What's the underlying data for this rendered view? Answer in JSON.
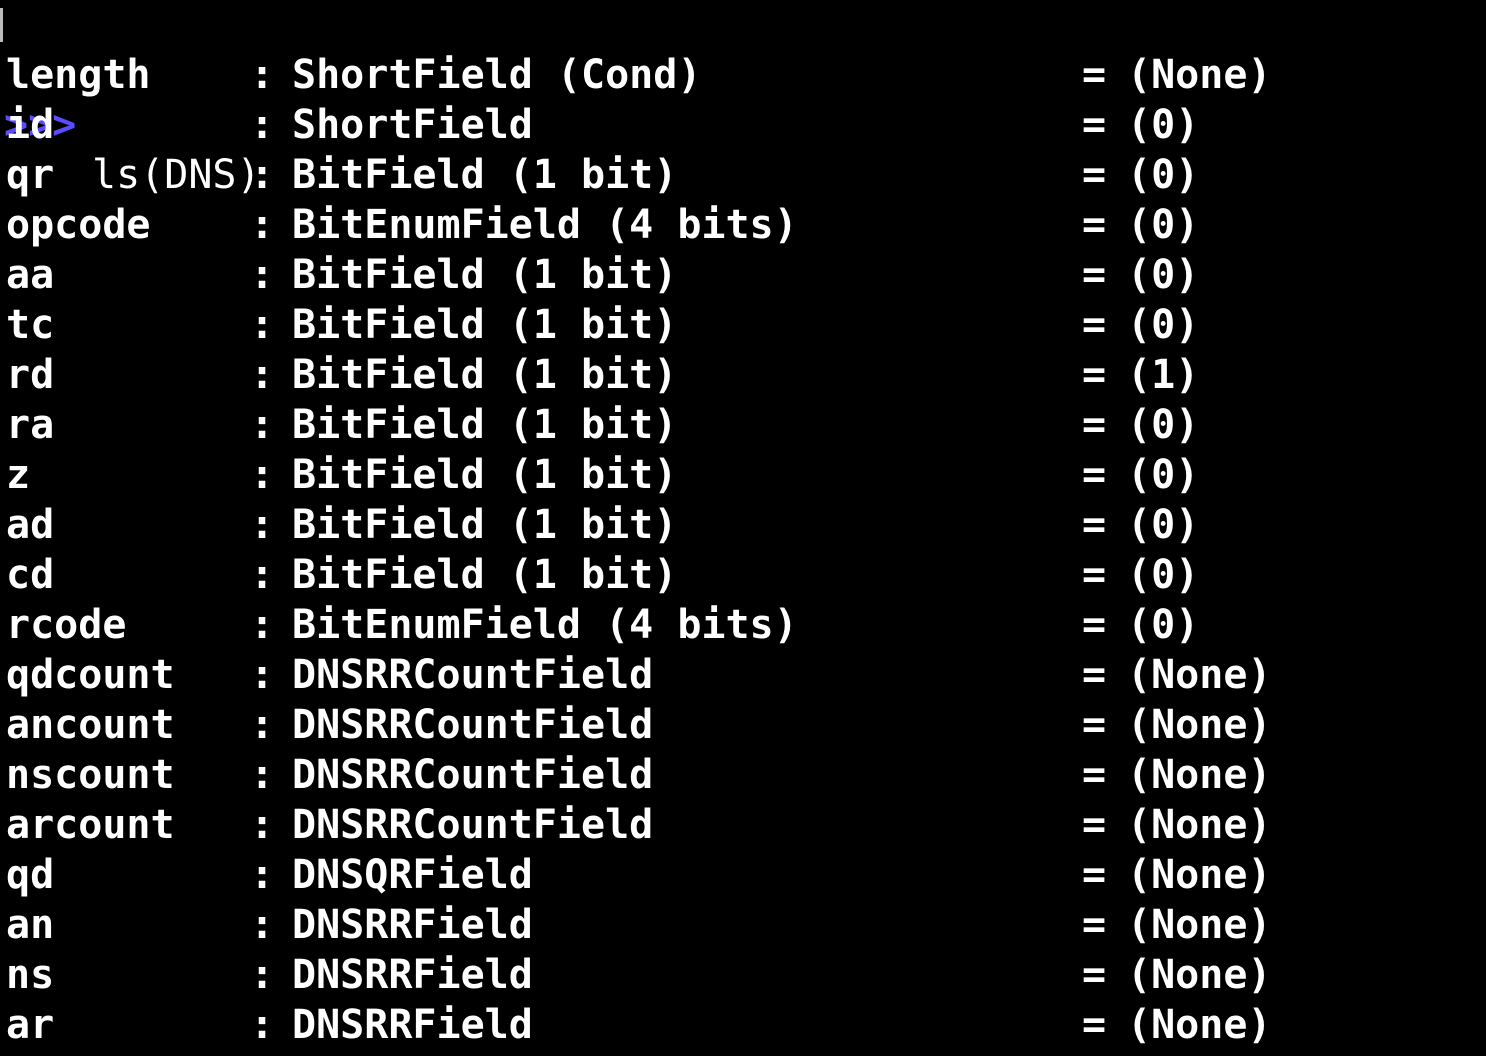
{
  "terminal": {
    "prompt": ">>>",
    "command": "ls(DNS)",
    "colors": {
      "background": "#000000",
      "text": "#ffffff",
      "prompt": "#5b4cff"
    },
    "rows": [
      {
        "name": "length",
        "sep": ":",
        "type": "ShortField (Cond)",
        "eq": "=",
        "value": "(None)"
      },
      {
        "name": "id",
        "sep": ":",
        "type": "ShortField",
        "eq": "=",
        "value": "(0)"
      },
      {
        "name": "qr",
        "sep": ":",
        "type": "BitField (1 bit)",
        "eq": "=",
        "value": "(0)"
      },
      {
        "name": "opcode",
        "sep": ":",
        "type": "BitEnumField (4 bits)",
        "eq": "=",
        "value": "(0)"
      },
      {
        "name": "aa",
        "sep": ":",
        "type": "BitField (1 bit)",
        "eq": "=",
        "value": "(0)"
      },
      {
        "name": "tc",
        "sep": ":",
        "type": "BitField (1 bit)",
        "eq": "=",
        "value": "(0)"
      },
      {
        "name": "rd",
        "sep": ":",
        "type": "BitField (1 bit)",
        "eq": "=",
        "value": "(1)"
      },
      {
        "name": "ra",
        "sep": ":",
        "type": "BitField (1 bit)",
        "eq": "=",
        "value": "(0)"
      },
      {
        "name": "z",
        "sep": ":",
        "type": "BitField (1 bit)",
        "eq": "=",
        "value": "(0)"
      },
      {
        "name": "ad",
        "sep": ":",
        "type": "BitField (1 bit)",
        "eq": "=",
        "value": "(0)"
      },
      {
        "name": "cd",
        "sep": ":",
        "type": "BitField (1 bit)",
        "eq": "=",
        "value": "(0)"
      },
      {
        "name": "rcode",
        "sep": ":",
        "type": "BitEnumField (4 bits)",
        "eq": "=",
        "value": "(0)"
      },
      {
        "name": "qdcount",
        "sep": ":",
        "type": "DNSRRCountField",
        "eq": "=",
        "value": "(None)"
      },
      {
        "name": "ancount",
        "sep": ":",
        "type": "DNSRRCountField",
        "eq": "=",
        "value": "(None)"
      },
      {
        "name": "nscount",
        "sep": ":",
        "type": "DNSRRCountField",
        "eq": "=",
        "value": "(None)"
      },
      {
        "name": "arcount",
        "sep": ":",
        "type": "DNSRRCountField",
        "eq": "=",
        "value": "(None)"
      },
      {
        "name": "qd",
        "sep": ":",
        "type": "DNSQRField",
        "eq": "=",
        "value": "(None)"
      },
      {
        "name": "an",
        "sep": ":",
        "type": "DNSRRField",
        "eq": "=",
        "value": "(None)"
      },
      {
        "name": "ns",
        "sep": ":",
        "type": "DNSRRField",
        "eq": "=",
        "value": "(None)"
      },
      {
        "name": "ar",
        "sep": ":",
        "type": "DNSRRField",
        "eq": "=",
        "value": "(None)"
      }
    ]
  }
}
